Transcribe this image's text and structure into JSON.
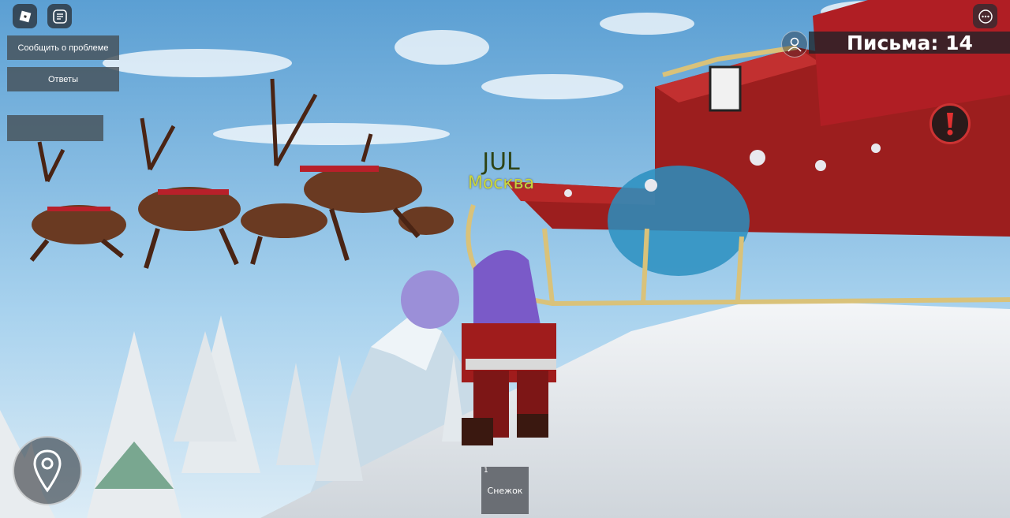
{
  "menu": {
    "report_button": "Сообщить о проблеме",
    "answers_button": "Ответы",
    "blank_button": ""
  },
  "hud": {
    "letters_label": "Письма: 14"
  },
  "player": {
    "name": "JUL",
    "city": "Москва"
  },
  "hotbar": {
    "slot_number": "1",
    "slot_label": "Снежок"
  },
  "icons": {
    "top_left": "roblox-logo-icon",
    "chat": "chat-icon",
    "menu": "more-icon",
    "profile": "profile-icon",
    "alert": "exclamation-icon",
    "map": "map-pin-icon"
  }
}
